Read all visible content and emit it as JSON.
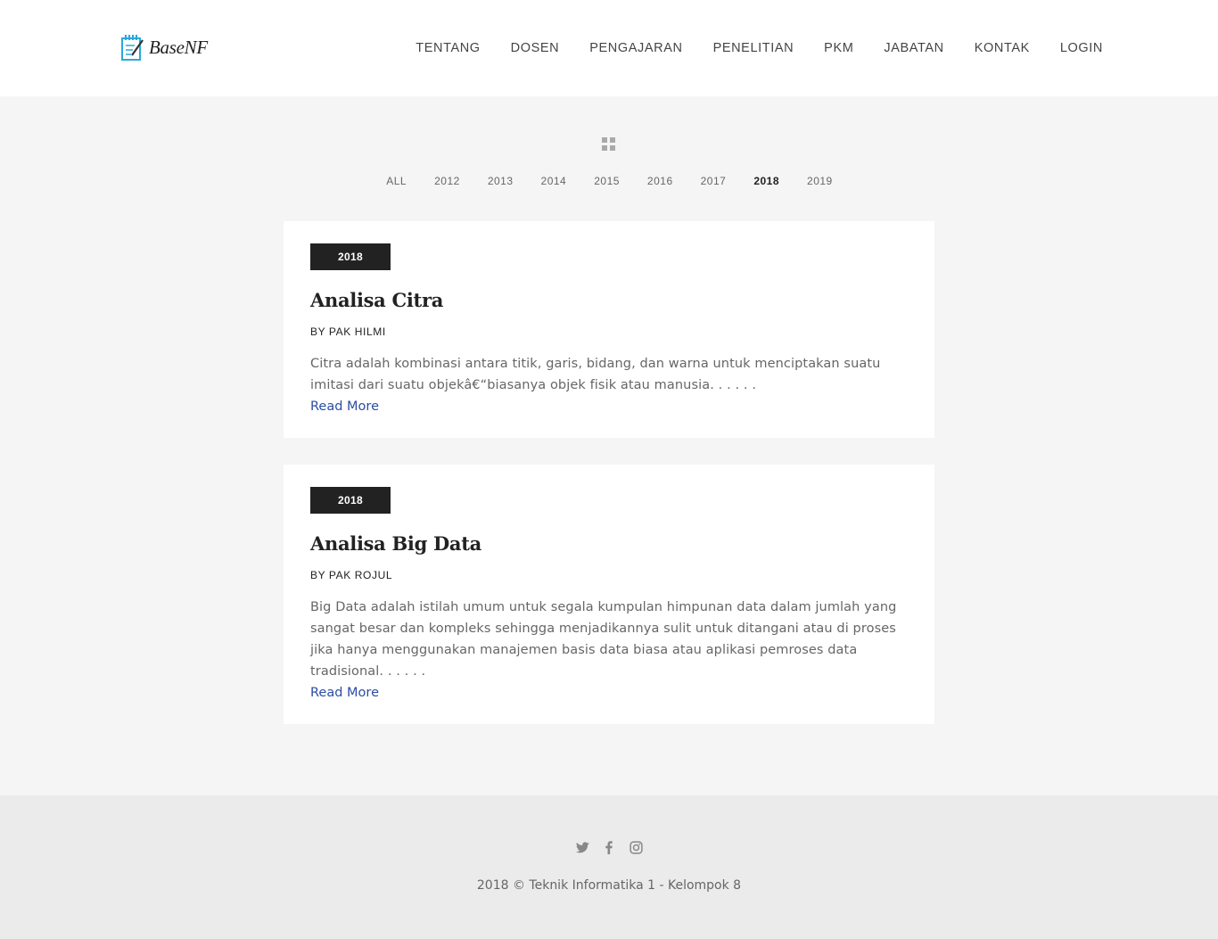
{
  "brand": {
    "name": "BaseNF",
    "icon": "notepad-pencil-icon",
    "accent": "#29a8e0"
  },
  "nav": {
    "items": [
      "TENTANG",
      "DOSEN",
      "PENGAJARAN",
      "PENELITIAN",
      "PKM",
      "JABATAN",
      "KONTAK",
      "LOGIN"
    ]
  },
  "filter": {
    "icon": "grid-icon",
    "items": [
      "ALL",
      "2012",
      "2013",
      "2014",
      "2015",
      "2016",
      "2017",
      "2018",
      "2019"
    ],
    "active": "2018"
  },
  "posts": [
    {
      "year": "2018",
      "title": "Analisa Citra",
      "author": "BY PAK HILMI",
      "excerpt_lines": [
        "Citra adalah kombinasi antara titik, garis, bidang, dan warna untuk menciptakan suatu",
        "imitasi dari suatu objekâ€“biasanya objek fisik atau manusia. . . . . ."
      ],
      "read_more": "Read More"
    },
    {
      "year": "2018",
      "title": "Analisa Big Data",
      "author": "BY PAK ROJUL",
      "excerpt_lines": [
        "Big Data adalah istilah umum untuk segala kumpulan himpunan data dalam jumlah yang",
        "sangat besar dan kompleks sehingga menjadikannya sulit untuk ditangani atau di proses",
        "jika hanya menggunakan manajemen basis data biasa atau aplikasi pemroses data",
        "tradisional. . . . . ."
      ],
      "read_more": "Read More"
    }
  ],
  "footer": {
    "socials": [
      "twitter-icon",
      "facebook-icon",
      "instagram-icon"
    ],
    "copyright": "2018 © Teknik Informatika 1 - Kelompok 8"
  },
  "colors": {
    "badge_bg": "#222222",
    "link": "#2b4da3",
    "page_bg": "#f5f5f5",
    "footer_bg": "#ebebeb"
  }
}
